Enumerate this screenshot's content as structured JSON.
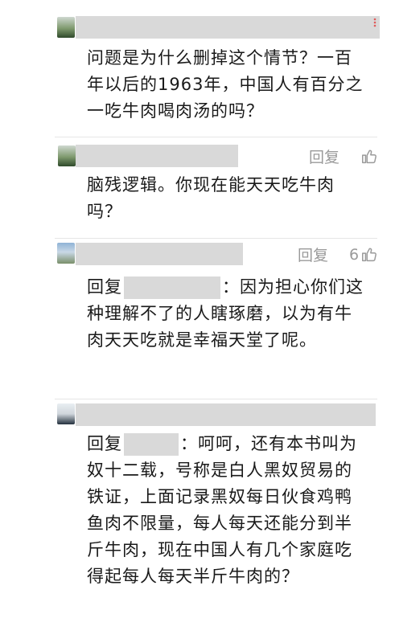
{
  "comments": [
    {
      "text": "问题是为什么删掉这个情节？一百年以后的1963年，中国人有百分之一吃牛肉喝肉汤的吗？"
    },
    {
      "reply_label": "回复",
      "text": "脑残逻辑。你现在能天天吃牛肉吗？"
    },
    {
      "reply_label": "回复",
      "like_count": "6",
      "reply_prefix": "回复",
      "text": "：因为担心你们这种理解不了的人瞎琢磨，以为有牛肉天天吃就是幸福天堂了呢。"
    },
    {
      "reply_prefix": "回复",
      "text": "：呵呵，还有本书叫为奴十二载，号称是白人黑奴贸易的铁证，上面记录黑奴每日伙食鸡鸭鱼肉不限量，每人每天还能分到半斤牛肉，现在中国人有几个家庭吃得起每人每天半斤牛肉的？"
    }
  ],
  "icons": {
    "like": "thumbs-up-icon",
    "more": "more-options-icon"
  },
  "colors": {
    "text": "#1a1a1a",
    "muted": "#9a9a9a",
    "redaction": "#d9d9d9"
  }
}
